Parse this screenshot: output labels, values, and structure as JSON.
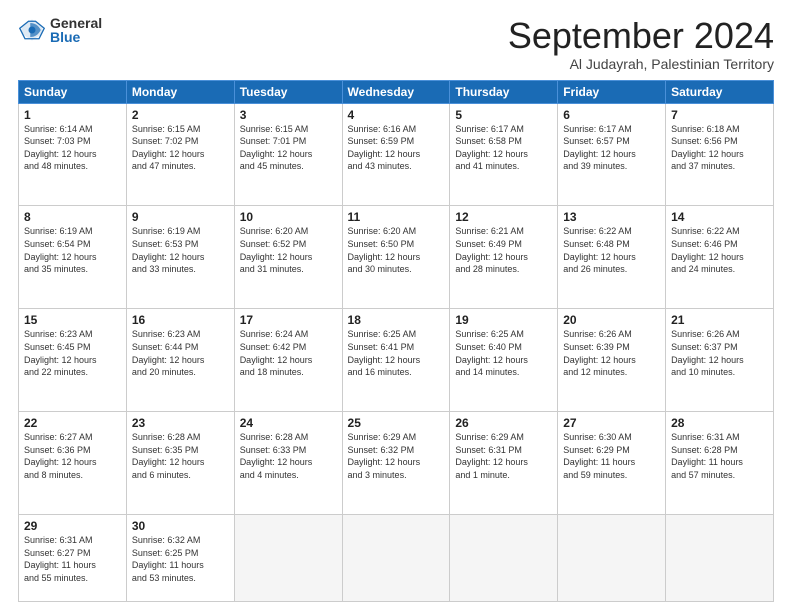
{
  "logo": {
    "general": "General",
    "blue": "Blue"
  },
  "title": "September 2024",
  "location": "Al Judayrah, Palestinian Territory",
  "headers": [
    "Sunday",
    "Monday",
    "Tuesday",
    "Wednesday",
    "Thursday",
    "Friday",
    "Saturday"
  ],
  "weeks": [
    [
      {
        "day": "1",
        "info": "Sunrise: 6:14 AM\nSunset: 7:03 PM\nDaylight: 12 hours\nand 48 minutes."
      },
      {
        "day": "2",
        "info": "Sunrise: 6:15 AM\nSunset: 7:02 PM\nDaylight: 12 hours\nand 47 minutes."
      },
      {
        "day": "3",
        "info": "Sunrise: 6:15 AM\nSunset: 7:01 PM\nDaylight: 12 hours\nand 45 minutes."
      },
      {
        "day": "4",
        "info": "Sunrise: 6:16 AM\nSunset: 6:59 PM\nDaylight: 12 hours\nand 43 minutes."
      },
      {
        "day": "5",
        "info": "Sunrise: 6:17 AM\nSunset: 6:58 PM\nDaylight: 12 hours\nand 41 minutes."
      },
      {
        "day": "6",
        "info": "Sunrise: 6:17 AM\nSunset: 6:57 PM\nDaylight: 12 hours\nand 39 minutes."
      },
      {
        "day": "7",
        "info": "Sunrise: 6:18 AM\nSunset: 6:56 PM\nDaylight: 12 hours\nand 37 minutes."
      }
    ],
    [
      {
        "day": "8",
        "info": "Sunrise: 6:19 AM\nSunset: 6:54 PM\nDaylight: 12 hours\nand 35 minutes."
      },
      {
        "day": "9",
        "info": "Sunrise: 6:19 AM\nSunset: 6:53 PM\nDaylight: 12 hours\nand 33 minutes."
      },
      {
        "day": "10",
        "info": "Sunrise: 6:20 AM\nSunset: 6:52 PM\nDaylight: 12 hours\nand 31 minutes."
      },
      {
        "day": "11",
        "info": "Sunrise: 6:20 AM\nSunset: 6:50 PM\nDaylight: 12 hours\nand 30 minutes."
      },
      {
        "day": "12",
        "info": "Sunrise: 6:21 AM\nSunset: 6:49 PM\nDaylight: 12 hours\nand 28 minutes."
      },
      {
        "day": "13",
        "info": "Sunrise: 6:22 AM\nSunset: 6:48 PM\nDaylight: 12 hours\nand 26 minutes."
      },
      {
        "day": "14",
        "info": "Sunrise: 6:22 AM\nSunset: 6:46 PM\nDaylight: 12 hours\nand 24 minutes."
      }
    ],
    [
      {
        "day": "15",
        "info": "Sunrise: 6:23 AM\nSunset: 6:45 PM\nDaylight: 12 hours\nand 22 minutes."
      },
      {
        "day": "16",
        "info": "Sunrise: 6:23 AM\nSunset: 6:44 PM\nDaylight: 12 hours\nand 20 minutes."
      },
      {
        "day": "17",
        "info": "Sunrise: 6:24 AM\nSunset: 6:42 PM\nDaylight: 12 hours\nand 18 minutes."
      },
      {
        "day": "18",
        "info": "Sunrise: 6:25 AM\nSunset: 6:41 PM\nDaylight: 12 hours\nand 16 minutes."
      },
      {
        "day": "19",
        "info": "Sunrise: 6:25 AM\nSunset: 6:40 PM\nDaylight: 12 hours\nand 14 minutes."
      },
      {
        "day": "20",
        "info": "Sunrise: 6:26 AM\nSunset: 6:39 PM\nDaylight: 12 hours\nand 12 minutes."
      },
      {
        "day": "21",
        "info": "Sunrise: 6:26 AM\nSunset: 6:37 PM\nDaylight: 12 hours\nand 10 minutes."
      }
    ],
    [
      {
        "day": "22",
        "info": "Sunrise: 6:27 AM\nSunset: 6:36 PM\nDaylight: 12 hours\nand 8 minutes."
      },
      {
        "day": "23",
        "info": "Sunrise: 6:28 AM\nSunset: 6:35 PM\nDaylight: 12 hours\nand 6 minutes."
      },
      {
        "day": "24",
        "info": "Sunrise: 6:28 AM\nSunset: 6:33 PM\nDaylight: 12 hours\nand 4 minutes."
      },
      {
        "day": "25",
        "info": "Sunrise: 6:29 AM\nSunset: 6:32 PM\nDaylight: 12 hours\nand 3 minutes."
      },
      {
        "day": "26",
        "info": "Sunrise: 6:29 AM\nSunset: 6:31 PM\nDaylight: 12 hours\nand 1 minute."
      },
      {
        "day": "27",
        "info": "Sunrise: 6:30 AM\nSunset: 6:29 PM\nDaylight: 11 hours\nand 59 minutes."
      },
      {
        "day": "28",
        "info": "Sunrise: 6:31 AM\nSunset: 6:28 PM\nDaylight: 11 hours\nand 57 minutes."
      }
    ],
    [
      {
        "day": "29",
        "info": "Sunrise: 6:31 AM\nSunset: 6:27 PM\nDaylight: 11 hours\nand 55 minutes."
      },
      {
        "day": "30",
        "info": "Sunrise: 6:32 AM\nSunset: 6:25 PM\nDaylight: 11 hours\nand 53 minutes."
      },
      {
        "day": "",
        "info": ""
      },
      {
        "day": "",
        "info": ""
      },
      {
        "day": "",
        "info": ""
      },
      {
        "day": "",
        "info": ""
      },
      {
        "day": "",
        "info": ""
      }
    ]
  ]
}
